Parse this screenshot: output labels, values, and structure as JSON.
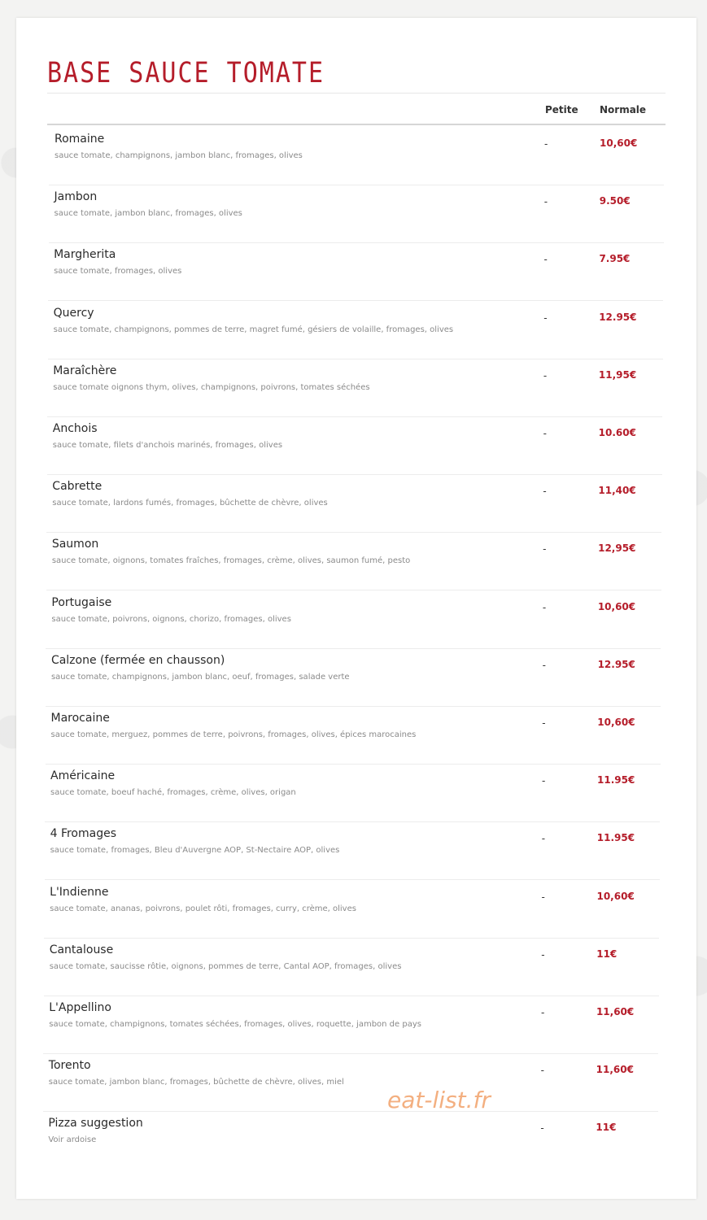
{
  "title": "BASE SAUCE TOMATE",
  "columns": {
    "petite": "Petite",
    "normale": "Normale"
  },
  "accent_color": "#b51d2a",
  "items": [
    {
      "name": "Romaine",
      "desc": "sauce tomate, champignons, jambon blanc, fromages, olives",
      "petite": "-",
      "price": "10,60€"
    },
    {
      "name": "Jambon",
      "desc": "sauce tomate, jambon blanc, fromages, olives",
      "petite": "-",
      "price": "9.50€"
    },
    {
      "name": "Margherita",
      "desc": "sauce tomate, fromages, olives",
      "petite": "-",
      "price": "7.95€"
    },
    {
      "name": "Quercy",
      "desc": "sauce tomate, champignons, pommes de terre, magret fumé, gésiers de volaille, fromages, olives",
      "petite": "-",
      "price": "12.95€"
    },
    {
      "name": "Maraîchère",
      "desc": "sauce tomate oignons thym, olives, champignons, poivrons, tomates séchées",
      "petite": "-",
      "price": "11,95€"
    },
    {
      "name": "Anchois",
      "desc": "sauce tomate, filets d'anchois marinés, fromages, olives",
      "petite": "-",
      "price": "10.60€"
    },
    {
      "name": "Cabrette",
      "desc": "sauce tomate, lardons fumés, fromages, bûchette de chèvre, olives",
      "petite": "-",
      "price": "11,40€"
    },
    {
      "name": "Saumon",
      "desc": "sauce tomate, oignons, tomates fraîches, fromages, crème, olives, saumon fumé, pesto",
      "petite": "-",
      "price": "12,95€"
    },
    {
      "name": "Portugaise",
      "desc": "sauce tomate, poivrons, oignons, chorizo, fromages, olives",
      "petite": "-",
      "price": "10,60€"
    },
    {
      "name": "Calzone (fermée en chausson)",
      "desc": "sauce tomate, champignons, jambon blanc, oeuf, fromages, salade verte",
      "petite": "-",
      "price": "12.95€"
    },
    {
      "name": "Marocaine",
      "desc": "sauce tomate, merguez, pommes de terre, poivrons, fromages, olives, épices marocaines",
      "petite": "-",
      "price": "10,60€"
    },
    {
      "name": "Américaine",
      "desc": "sauce tomate, boeuf haché, fromages, crème, olives, origan",
      "petite": "-",
      "price": "11.95€"
    },
    {
      "name": "4 Fromages",
      "desc": "sauce tomate, fromages, Bleu d'Auvergne AOP, St-Nectaire AOP, olives",
      "petite": "-",
      "price": "11.95€"
    },
    {
      "name": "L'Indienne",
      "desc": "sauce tomate, ananas, poivrons, poulet rôti, fromages, curry, crème, olives",
      "petite": "-",
      "price": "10,60€"
    },
    {
      "name": "Cantalouse",
      "desc": "sauce tomate, saucisse rôtie, oignons, pommes de terre, Cantal AOP, fromages, olives",
      "petite": "-",
      "price": "11€"
    },
    {
      "name": "L'Appellino",
      "desc": "sauce tomate, champignons, tomates séchées, fromages, olives, roquette, jambon de pays",
      "petite": "-",
      "price": "11,60€"
    },
    {
      "name": "Torento",
      "desc": "sauce tomate, jambon blanc, fromages, bûchette de chèvre, olives, miel",
      "petite": "-",
      "price": "11,60€"
    },
    {
      "name": "Pizza suggestion",
      "desc": "Voir ardoise",
      "petite": "-",
      "price": "11€"
    }
  ],
  "watermark": "eat-list.fr"
}
